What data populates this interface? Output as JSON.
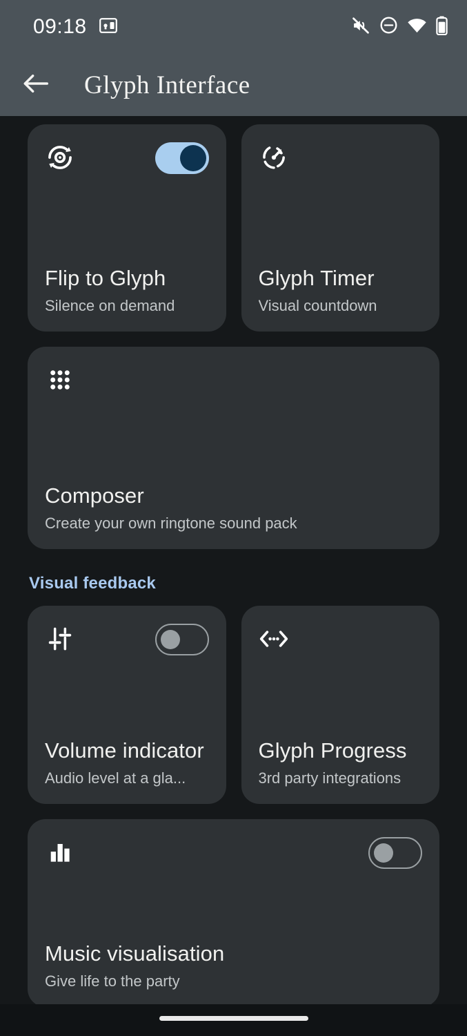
{
  "statusbar": {
    "time": "09:18",
    "icons_left": [
      "cast-icon"
    ],
    "icons_right": [
      "ringer-mute-icon",
      "do-not-disturb-icon",
      "wifi-icon",
      "battery-icon"
    ]
  },
  "appbar": {
    "back_label": "back-arrow",
    "title": "Glyph Interface"
  },
  "sections": [
    {
      "header": null,
      "cards": [
        {
          "icon": "flip-rotate-icon",
          "title": "Flip to Glyph",
          "subtitle": "Silence on demand",
          "toggle": "on"
        },
        {
          "icon": "timer-progress-icon",
          "title": "Glyph Timer",
          "subtitle": "Visual countdown",
          "toggle": null
        },
        {
          "icon": "grid-dots-icon",
          "title": "Composer",
          "subtitle": "Create your own ringtone sound pack",
          "toggle": null
        }
      ]
    },
    {
      "header": "Visual feedback",
      "cards": [
        {
          "icon": "sliders-icon",
          "title": "Volume indicator",
          "subtitle": "Audio level at a gla...",
          "toggle": "off"
        },
        {
          "icon": "code-brackets-icon",
          "title": "Glyph Progress",
          "subtitle": "3rd party integrations",
          "toggle": null
        },
        {
          "icon": "bar-chart-icon",
          "title": "Music visualisation",
          "subtitle": "Give life to the party",
          "toggle": "off"
        }
      ]
    }
  ],
  "colors": {
    "page_background": "#15181a",
    "appbar_background": "#4b5359",
    "card_background": "#2e3235",
    "accent": "#a9c9ef",
    "toggle_on_track": "#a9ceef",
    "toggle_on_knob": "#0d3350",
    "toggle_off_knob": "#9aa0a3"
  },
  "navbar": {
    "gesture_pill": "home-gesture-pill"
  }
}
